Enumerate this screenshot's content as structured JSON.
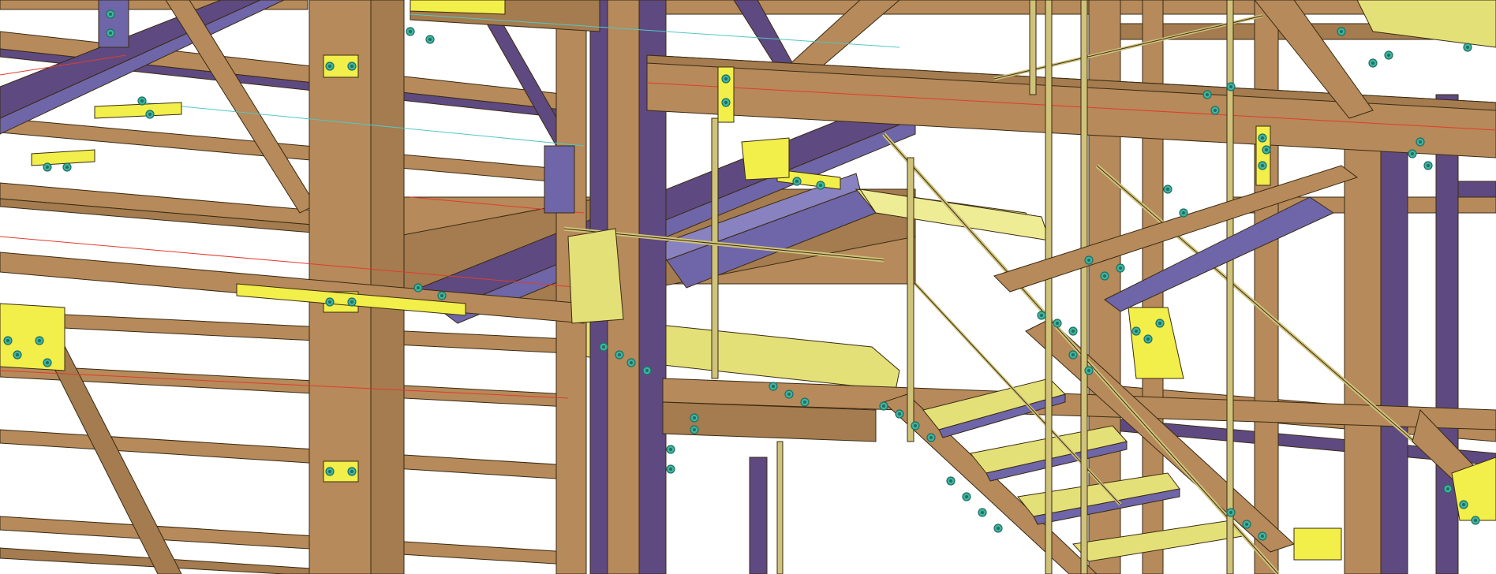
{
  "viewport": {
    "kind": "3d-structural-steel-model",
    "background_color": "#ffffff"
  },
  "colors": {
    "member_web": "#b68a5a",
    "member_flange": "#a47c4f",
    "member_shadow": "#5e4a80",
    "member_shadow_light": "#6e66a8",
    "plate": "#e4e078",
    "plate_bright": "#f2ee4a",
    "edge": "#3a2a14",
    "bolt": "#3fb4a0",
    "bolt_dark": "#1f6f62",
    "centerline_red": "#e23b2e",
    "centerline_cyan": "#52c7c7"
  },
  "icons": {
    "bolt": "bolt-icon"
  },
  "stair": {
    "tread_count": 4,
    "treads_visible": "4"
  }
}
